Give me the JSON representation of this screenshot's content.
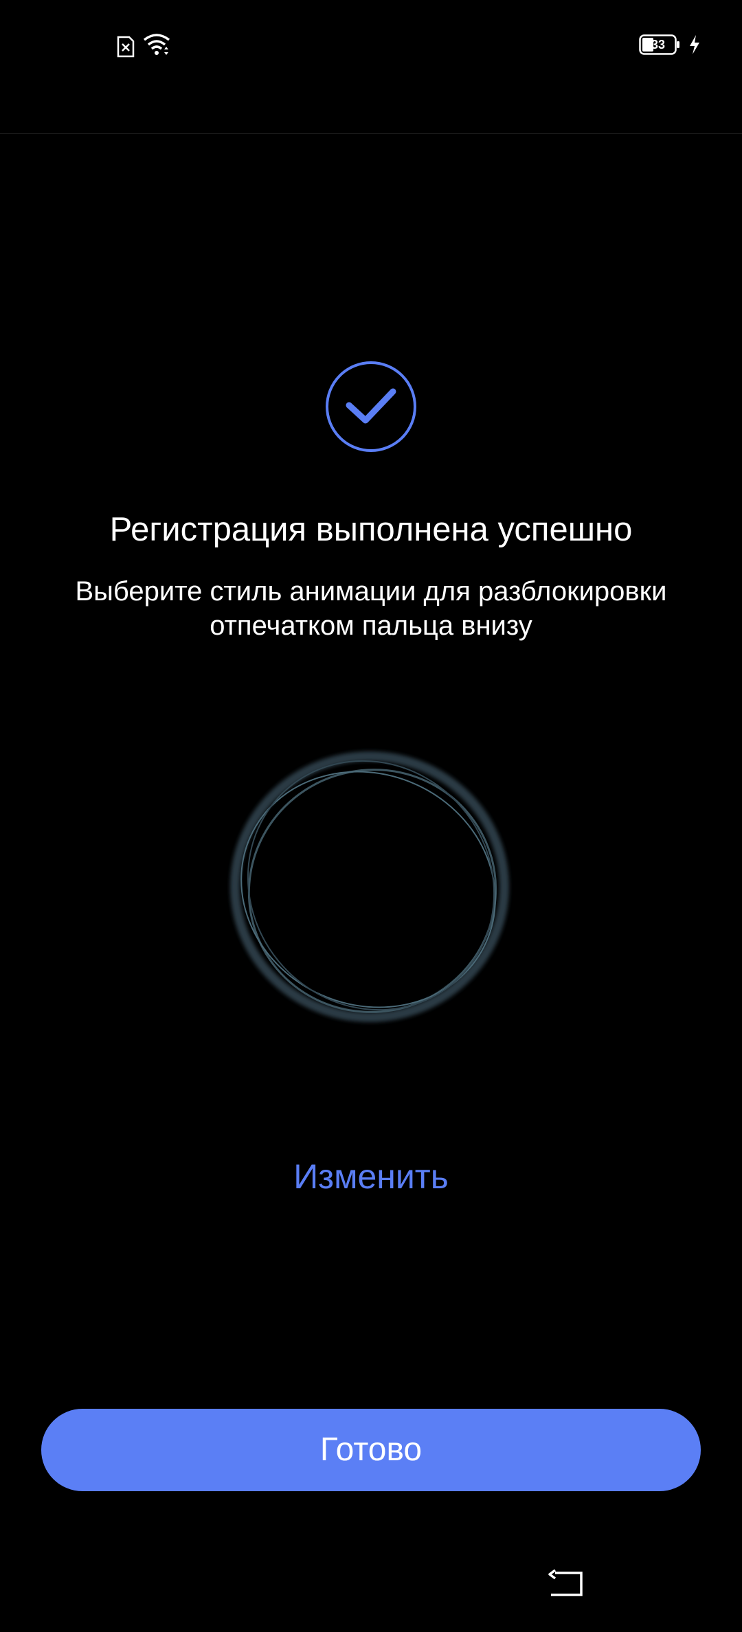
{
  "status_bar": {
    "battery_level": "33",
    "icons": [
      "sim-missing-icon",
      "wifi-icon",
      "battery-icon",
      "charging-icon"
    ]
  },
  "main": {
    "success_icon": "check-circle-icon",
    "title": "Регистрация выполнена успешно",
    "subtitle": "Выберите стиль анимации для разблокировки отпечатком пальца внизу",
    "animation_preview_icon": "ring-animation-icon",
    "change_label": "Изменить"
  },
  "footer": {
    "done_label": "Готово"
  },
  "nav_bar": {
    "back_icon": "back-icon"
  },
  "colors": {
    "background": "#000000",
    "accent": "#5b7ff5",
    "text": "#ffffff"
  }
}
